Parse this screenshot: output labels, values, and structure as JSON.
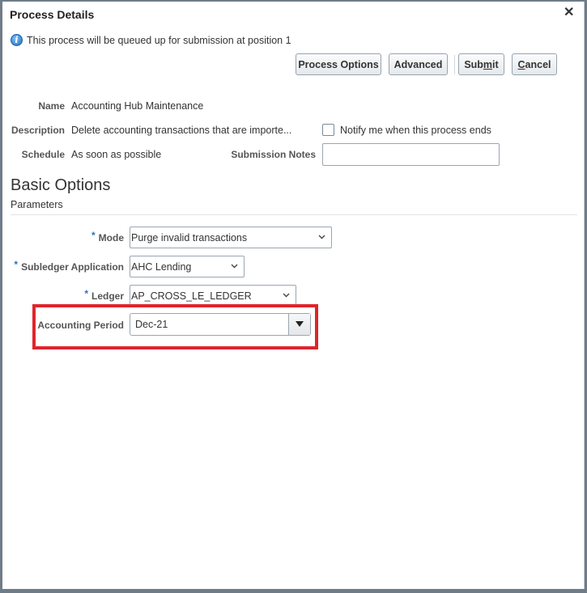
{
  "dialog": {
    "title": "Process Details",
    "close_icon": "close-icon",
    "info_message": "This process will be queued up for submission at position 1",
    "info_icon": "info-icon"
  },
  "toolbar": {
    "process_options_label": "Process Options",
    "advanced_label": "Advanced",
    "submit_label": "Submit",
    "submit_accesskey": "m",
    "cancel_label": "Cancel",
    "cancel_accesskey": "C"
  },
  "details": {
    "name_label": "Name",
    "name_value": "Accounting Hub Maintenance",
    "description_label": "Description",
    "description_value": "Delete accounting transactions that are importe...",
    "schedule_label": "Schedule",
    "schedule_value": "As soon as possible",
    "notify_label": "Notify me when this process ends",
    "notify_checked": false,
    "submission_notes_label": "Submission Notes",
    "submission_notes_value": ""
  },
  "basic_options": {
    "title": "Basic Options",
    "subtitle": "Parameters",
    "required_marker": "*",
    "parameters": [
      {
        "label": "Mode",
        "required": true,
        "value": "Purge invalid transactions"
      },
      {
        "label": "Subledger Application",
        "required": true,
        "value": "AHC Lending"
      },
      {
        "label": "Ledger",
        "required": true,
        "value": "AP_CROSS_LE_LEDGER"
      },
      {
        "label": "Accounting Period",
        "required": false,
        "value": "Dec-21"
      }
    ]
  },
  "annotation": {
    "highlight_color": "#e0242d",
    "highlighted_field": "Accounting Period"
  }
}
